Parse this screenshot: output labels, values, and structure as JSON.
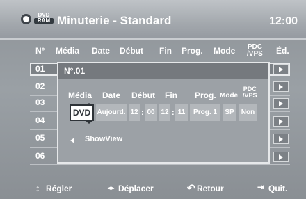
{
  "header": {
    "disc_badge_top": "DVD",
    "disc_badge_bottom": "RAM",
    "title": "Minuterie - Standard",
    "clock": "12:00"
  },
  "columns": {
    "no": "N°",
    "media": "Média",
    "date": "Date",
    "start": "Début",
    "end": "Fin",
    "prog": "Prog.",
    "mode": "Mode",
    "pdc_line1": "PDC",
    "pdc_line2": "/VPS",
    "edit": "Éd."
  },
  "rows": [
    "01",
    "02",
    "03",
    "04",
    "05",
    "06"
  ],
  "dialog": {
    "title": "N°.01",
    "labels": {
      "media": "Média",
      "date": "Date",
      "start": "Début",
      "end": "Fin",
      "prog": "Prog.",
      "mode": "Mode",
      "pdc_line1": "PDC",
      "pdc_line2": "/VPS"
    },
    "values": {
      "media": "DVD",
      "date": "Aujourd.",
      "start_h": "12",
      "start_m": "00",
      "end_h": "12",
      "end_m": "11",
      "prog": "Prog. 1",
      "mode": "SP",
      "pdc": "Non"
    },
    "colon": ":",
    "showview": "ShowView"
  },
  "footer": {
    "adjust": "Régler",
    "move": "Déplacer",
    "back": "Retour",
    "quit": "Quit."
  }
}
